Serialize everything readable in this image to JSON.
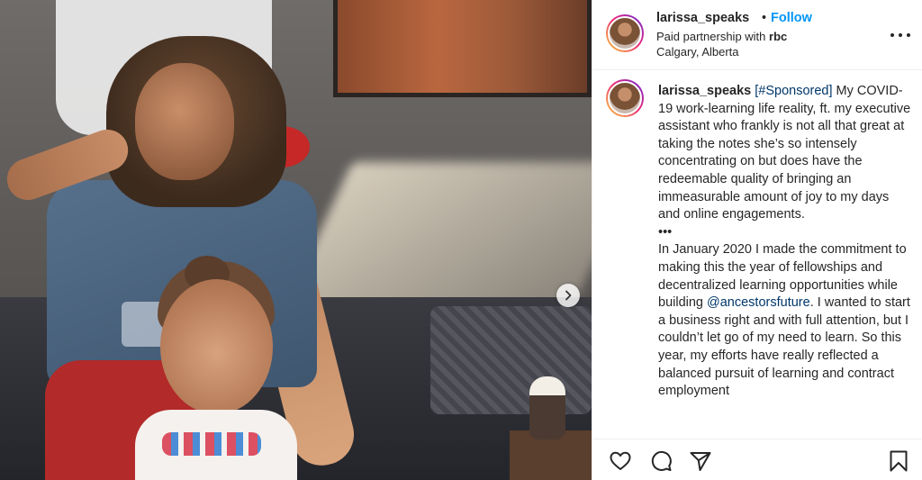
{
  "post": {
    "username": "larissa_speaks",
    "separator": "•",
    "follow_label": "Follow",
    "partnership_prefix": "Paid partnership with",
    "partner": "rbc",
    "location": "Calgary, Alberta"
  },
  "caption": {
    "username": "larissa_speaks",
    "tag": "[#Sponsored]",
    "para1": " My COVID-19 work-learning life reality, ft. my executive assistant who frankly is not all that great at taking the notes she’s so intensely concentrating on but does have the redeemable quality of bringing an immeasurable amount of joy to my days and online engagements.",
    "ellipsis": "•••",
    "para2_start": "In January 2020 I made the commitment to making this the year of fellowships and decentralized learning opportunities while building ",
    "mention": "@ancestorsfuture",
    "para2_end": ". I wanted to start a business right and with full attention, but I couldn’t let go of my need to learn. So this year, my efforts have really reflected a balanced pursuit of learning and contract employment"
  },
  "icons": {
    "next": "chevron-right-icon",
    "more": "more-options-icon",
    "like": "heart-icon",
    "comment": "comment-icon",
    "share": "send-icon",
    "save": "bookmark-icon"
  },
  "colors": {
    "follow": "#0095f6",
    "link": "#00376b",
    "text": "#262626",
    "divider": "#efefef"
  }
}
